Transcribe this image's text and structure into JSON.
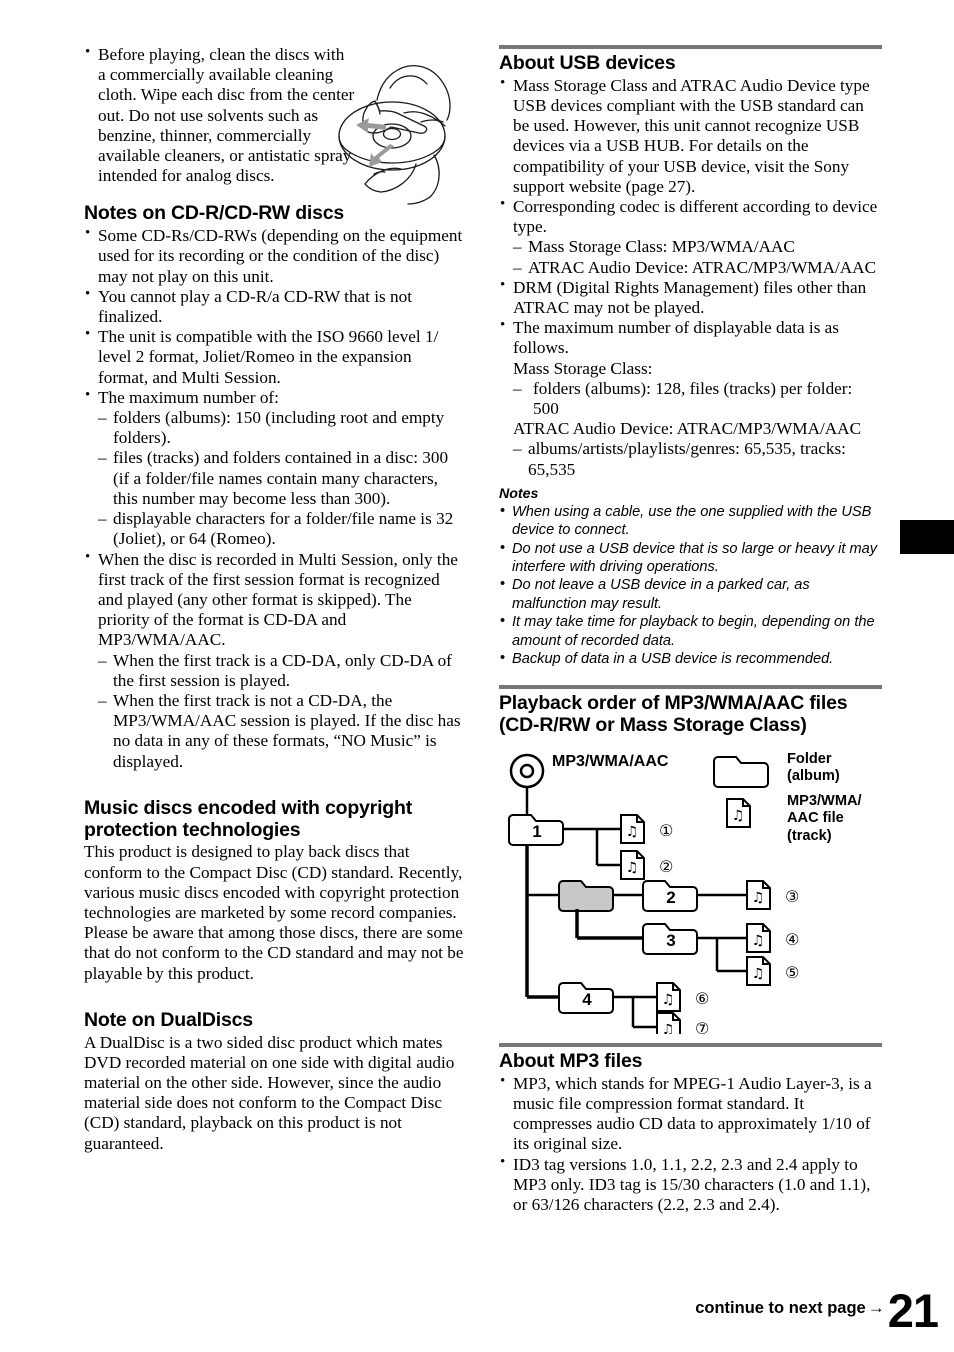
{
  "page_number": "21",
  "footer": {
    "continue_label": "continue to next page",
    "arrow": "→"
  },
  "colors": {
    "rule": "#77777a",
    "folder_highlight": "#c8c8c8",
    "ink": "#000000"
  },
  "left_column": {
    "intro_bullets": [
      "Before playing, clean the discs with a commercially available cleaning cloth. Wipe each disc from the center out. Do not use solvents such as benzine, thinner, commercially available cleaners, or antistatic spray intended for analog discs."
    ],
    "illustration": {
      "name": "disc-cleaning-illustration",
      "description": "Hand wiping a compact disc from the center outward with a cloth"
    },
    "sections": [
      {
        "heading": "Notes on CD-R/CD-RW discs",
        "bullets": [
          "Some CD-Rs/CD-RWs (depending on the equipment used for its recording or the condition of the disc) may not play on this unit.",
          "You cannot play a CD-R/a CD-RW that is not finalized.",
          "The unit is compatible with the ISO 9660 level 1/ level 2 format, Joliet/Romeo in the expansion format, and Multi Session."
        ],
        "bullet_with_subs_1": {
          "text": "The maximum number of:",
          "subs": [
            "folders (albums): 150 (including root and empty folders).",
            "files (tracks) and folders contained in a disc: 300 (if a folder/file names contain many characters, this number may become less than 300).",
            "displayable characters for a folder/file name is 32 (Joliet), or 64 (Romeo)."
          ]
        },
        "bullet_with_subs_2": {
          "text": "When the disc is recorded in Multi Session, only the first track of the first session format is recognized and played (any other format is skipped). The priority of the format is CD-DA and MP3/WMA/AAC.",
          "subs": [
            "When the first track is a CD-DA, only CD-DA of the first session is played.",
            "When the first track is not a CD-DA, the MP3/WMA/AAC session is played. If the disc has no data in any of these formats, “NO Music” is displayed."
          ]
        }
      },
      {
        "heading": "Music discs encoded with copyright protection technologies",
        "paragraph": "This product is designed to play back discs that conform to the Compact Disc (CD) standard. Recently, various music discs encoded with copyright protection technologies are marketed by some record companies. Please be aware that among those discs, there are some that do not conform to the CD standard and may not be playable by this product."
      },
      {
        "heading": "Note on DualDiscs",
        "paragraph": "A DualDisc is a two sided disc product which mates DVD recorded material on one side with digital audio material on the other side. However, since the audio material side does not conform to the Compact Disc (CD) standard, playback on this product is not guaranteed."
      }
    ]
  },
  "right_column": {
    "usb": {
      "heading": "About USB devices",
      "bullet_1": "Mass Storage Class and ATRAC Audio Device type USB devices compliant with the USB standard can be used. However, this unit cannot recognize USB devices via a USB HUB. For details on the compatibility of your USB device, visit the Sony support website (page 27).",
      "bullet_2": {
        "text": "Corresponding codec is different according to device type.",
        "subs": [
          "Mass Storage Class: MP3/WMA/AAC",
          "ATRAC Audio Device: ATRAC/MP3/WMA/AAC"
        ]
      },
      "bullet_3": "DRM (Digital Rights Management) files other than ATRAC may not be played.",
      "bullet_4": {
        "text": "The maximum number of displayable data is as follows.",
        "label_1": "Mass Storage Class:",
        "sub_1": "folders (albums): 128, files (tracks) per folder: 500",
        "label_2": "ATRAC Audio Device: ATRAC/MP3/WMA/AAC",
        "sub_2": "albums/artists/playlists/genres: 65,535, tracks: 65,535"
      },
      "notes_heading": "Notes",
      "notes": [
        "When using a cable, use the one supplied with the USB device to connect.",
        "Do not use a USB device that is so large or heavy it may interfere with driving operations.",
        "Do not leave a USB device in a parked car, as malfunction may result.",
        "It may take time for playback to begin, depending on the amount of recorded data.",
        "Backup of data in a USB device is recommended."
      ]
    },
    "playback_order": {
      "heading": "Playback order of MP3/WMA/AAC files (CD-R/RW or Mass Storage Class)",
      "diagram": {
        "root_label": "MP3/WMA/AAC",
        "legend": [
          {
            "icon": "folder-icon",
            "label": "Folder\n(album)"
          },
          {
            "icon": "music-file-icon",
            "label": "MP3/WMA/\nAAC file\n(track)"
          }
        ],
        "legend_folder_line1": "Folder",
        "legend_folder_line2": "(album)",
        "legend_file_line1": "MP3/WMA/",
        "legend_file_line2": "AAC file",
        "legend_file_line3": "(track)",
        "folders": [
          "1",
          "",
          "2",
          "3",
          "4"
        ],
        "tracks": [
          "①",
          "②",
          "③",
          "④",
          "⑤",
          "⑥",
          "⑦"
        ]
      }
    },
    "mp3": {
      "heading": "About MP3 files",
      "bullets": [
        "MP3, which stands for MPEG-1 Audio Layer-3, is a music file compression format standard. It compresses audio CD data to approximately 1/10 of its original size.",
        "ID3 tag versions 1.0, 1.1, 2.2, 2.3 and 2.4 apply to MP3 only. ID3 tag is 15/30 characters (1.0 and 1.1), or 63/126 characters (2.2, 2.3 and 2.4)."
      ]
    }
  }
}
